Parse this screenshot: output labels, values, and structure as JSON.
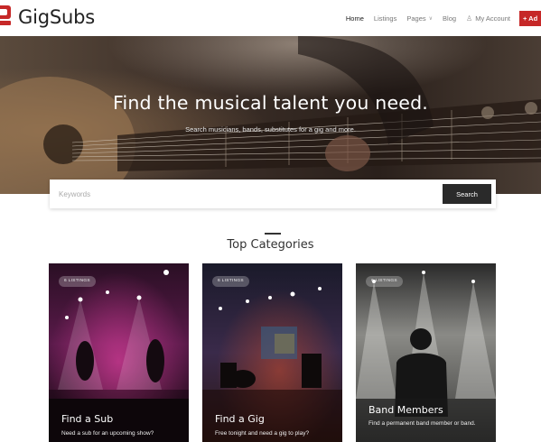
{
  "header": {
    "logo_text": "GigSubs",
    "nav": [
      {
        "label": "Home"
      },
      {
        "label": "Listings"
      },
      {
        "label": "Pages"
      },
      {
        "label": "Blog"
      },
      {
        "label": "My Account"
      }
    ],
    "add_label": "+ Ad"
  },
  "hero": {
    "title": "Find the musical talent you need.",
    "subtitle": "Search musicians, bands, substitutes for a gig and more."
  },
  "search": {
    "placeholder": "Keywords",
    "value": "",
    "button_label": "Search"
  },
  "categories": {
    "title": "Top Categories",
    "items": [
      {
        "badge": "6 LISTINGS",
        "title": "Find a Sub",
        "desc": "Need a sub for an upcoming show?"
      },
      {
        "badge": "6 LISTINGS",
        "title": "Find a Gig",
        "desc": "Free tonight and need a gig to play?"
      },
      {
        "badge": "6 LISTINGS",
        "title": "Band Members",
        "desc": "Find a permanent band member or band."
      }
    ]
  },
  "colors": {
    "accent": "#c62828",
    "dark_button": "#2a2a2a"
  },
  "icons": {
    "logo": "gigsubs-logo-icon",
    "user": "user-icon",
    "chevron": "chevron-down-icon"
  }
}
